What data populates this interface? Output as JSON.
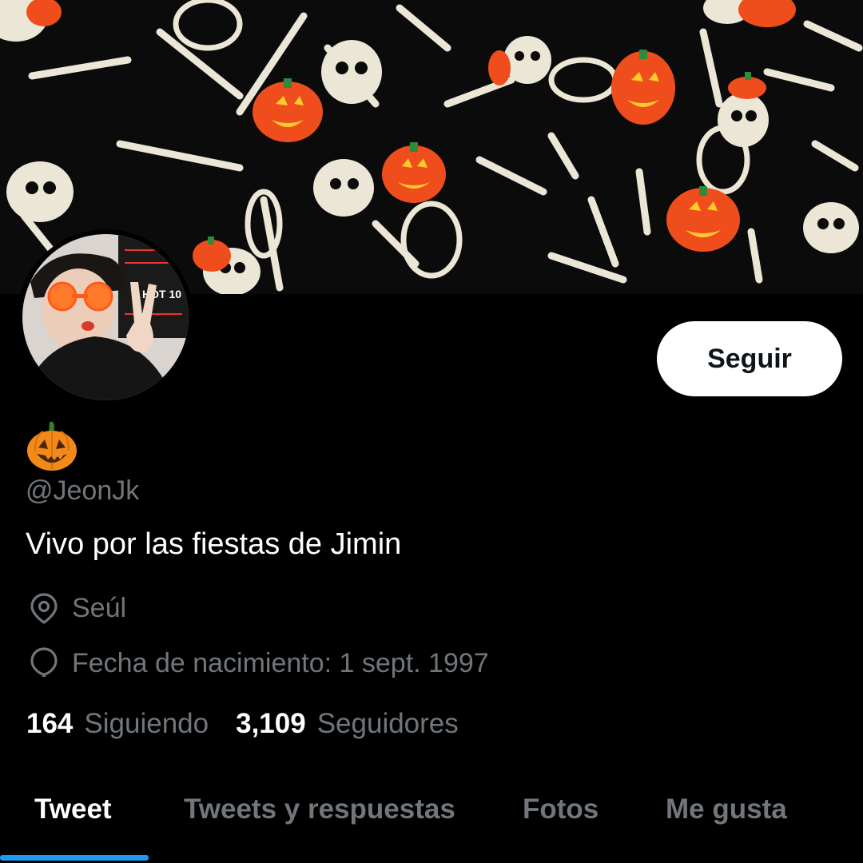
{
  "profile": {
    "display_name_emoji": "🎃",
    "handle": "@JeonJk",
    "bio": "Vivo por las fiestas de Jimin",
    "location": "Seúl",
    "birthday": "Fecha de nacimiento: 1 sept. 1997",
    "following_count": "164",
    "following_label": "Siguiendo",
    "followers_count": "3,109",
    "followers_label": "Seguidores"
  },
  "actions": {
    "follow_label": "Seguir"
  },
  "avatar": {
    "sign_text": "HOT 10"
  },
  "tabs": [
    {
      "label": "Tweet",
      "active": true
    },
    {
      "label": "Tweets y respuestas",
      "active": false
    },
    {
      "label": "Fotos",
      "active": false
    },
    {
      "label": "Me gusta",
      "active": false
    }
  ],
  "colors": {
    "background": "#000000",
    "secondary_text": "#71767b",
    "accent": "#1d9bf0",
    "pumpkin": "#f4511e"
  }
}
